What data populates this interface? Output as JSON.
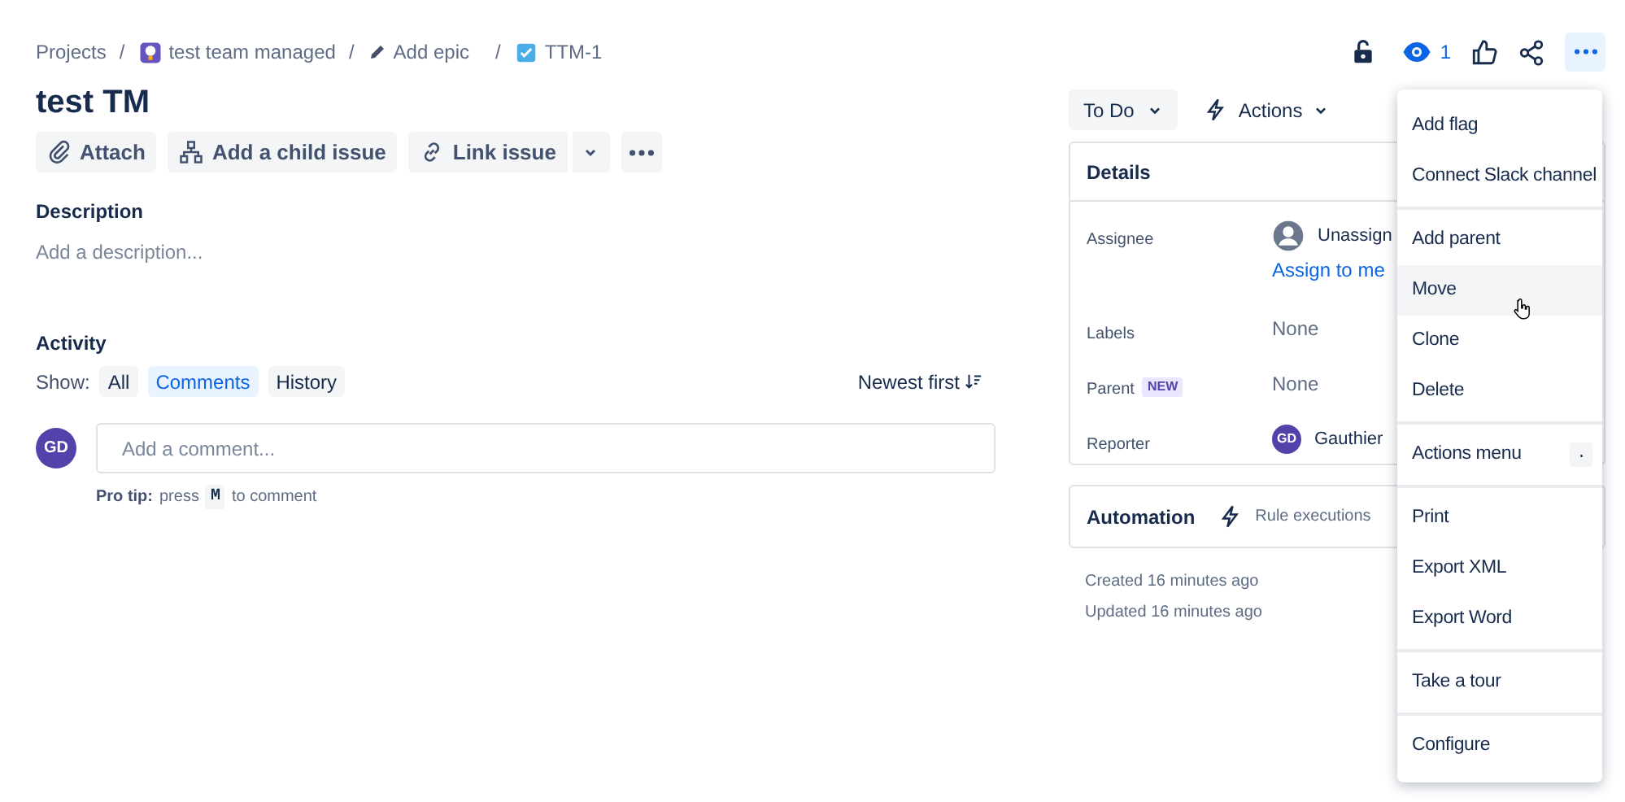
{
  "breadcrumbs": [
    {
      "label": "Projects"
    },
    {
      "separator": "/",
      "label": "test team managed"
    },
    {
      "separator": "/",
      "label": "Add epic"
    },
    {
      "separator": "/",
      "label": "TTM-1"
    }
  ],
  "title": "test TM",
  "toolbar": [
    {
      "label": "Attach"
    },
    {
      "label": "Add a child issue"
    },
    {
      "label": "Link issue"
    }
  ],
  "description": {
    "heading": "Description",
    "placeholder": "Add a description..."
  },
  "activity": {
    "heading": "Activity",
    "show_label": "Show:",
    "filters": [
      {
        "label": "All",
        "selected": false
      },
      {
        "label": "Comments",
        "selected": true
      },
      {
        "label": "History",
        "selected": false
      }
    ],
    "sort": "Newest first",
    "avatar": "GD",
    "comment_placeholder": "Add a comment...",
    "tip_bold": "Pro tip:",
    "tip_before": "press",
    "tip_key": "M",
    "tip_after": "to comment"
  },
  "header_actions": {
    "watchers": "1",
    "more_pressed": true
  },
  "status": {
    "label": "To Do",
    "actions": "Actions"
  },
  "details": {
    "heading": "Details",
    "fields": [
      {
        "label": "Assignee",
        "kind": "assignee",
        "value": "Unassign",
        "link": "Assign to me"
      },
      {
        "label": "Labels",
        "kind": "text",
        "value": "None"
      },
      {
        "label": "Parent",
        "kind": "text",
        "badge": "NEW",
        "value": "None"
      },
      {
        "label": "Reporter",
        "kind": "user",
        "avatar": "GD",
        "value": "Gauthier"
      }
    ]
  },
  "automation": {
    "heading": "Automation",
    "link": "Rule executions"
  },
  "timestamps": [
    "Created 16 minutes ago",
    "Updated 16 minutes ago"
  ],
  "menu": [
    [
      {
        "label": "Add flag",
        "hovered": false
      },
      {
        "label": "Connect Slack channel",
        "hovered": false
      }
    ],
    [
      {
        "label": "Add parent",
        "hovered": false
      },
      {
        "label": "Move",
        "hovered": true
      },
      {
        "label": "Clone",
        "hovered": false
      },
      {
        "label": "Delete",
        "hovered": false
      }
    ],
    [
      {
        "label": "Actions menu",
        "hovered": false,
        "shortcut": "."
      }
    ],
    [
      {
        "label": "Print",
        "hovered": false
      },
      {
        "label": "Export XML",
        "hovered": false
      },
      {
        "label": "Export Word",
        "hovered": false
      }
    ],
    [
      {
        "label": "Take a tour",
        "hovered": false
      }
    ],
    [
      {
        "label": "Configure",
        "hovered": false
      }
    ]
  ]
}
